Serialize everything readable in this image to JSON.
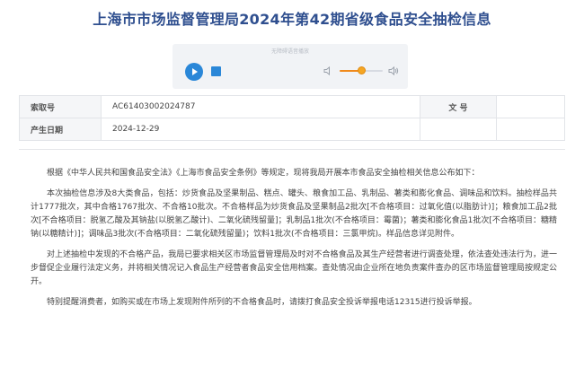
{
  "page": {
    "title": "上海市市场监督管理局2024年第42期省级食品安全抽检信息"
  },
  "audio_player": {
    "caption": "无障碍语音播放",
    "volume_level": 0.5
  },
  "meta": {
    "index_label": "索取号",
    "index_value": "AC61403002024787",
    "doc_no_label": "文 号",
    "doc_no_value": "",
    "date_label": "产生日期",
    "date_value": "2024-12-29"
  },
  "content": {
    "paragraphs": [
      "根据《中华人民共和国食品安全法》《上海市食品安全条例》等规定，现将我局开展本市食品安全抽检相关信息公布如下：",
      "本次抽检信息涉及8大类食品，包括：炒货食品及坚果制品、糕点、罐头、粮食加工品、乳制品、薯类和膨化食品、调味品和饮料。抽检样品共计1777批次，其中合格1767批次、不合格10批次。不合格样品为炒货食品及坚果制品2批次[不合格项目：过氧化值(以脂肪计)]；粮食加工品2批次[不合格项目：脱氢乙酸及其钠盐(以脱氢乙酸计)、二氧化硫残留量]；乳制品1批次(不合格项目：霉菌)；薯类和膨化食品1批次[不合格项目：糖精钠(以糖精计)]；调味品3批次(不合格项目：二氧化硫残留量)；饮料1批次(不合格项目：三氯甲烷)。样品信息详见附件。",
      "对上述抽检中发现的不合格产品，我局已要求相关区市场监督管理局及时对不合格食品及其生产经营者进行调查处理，依法查处违法行为，进一步督促企业履行法定义务，并将相关情况记入食品生产经营者食品安全信用档案。查处情况由企业所在地负责案件查办的区市场监督管理局按规定公开。",
      "特别提醒消费者，如购买或在市场上发现附件所列的不合格食品时，请拨打食品安全投诉举报电话12315进行投诉举报。"
    ]
  },
  "colors": {
    "title": "#2f4f8f",
    "player_button": "#2a87d8",
    "volume_fill": "#f08a1c"
  }
}
